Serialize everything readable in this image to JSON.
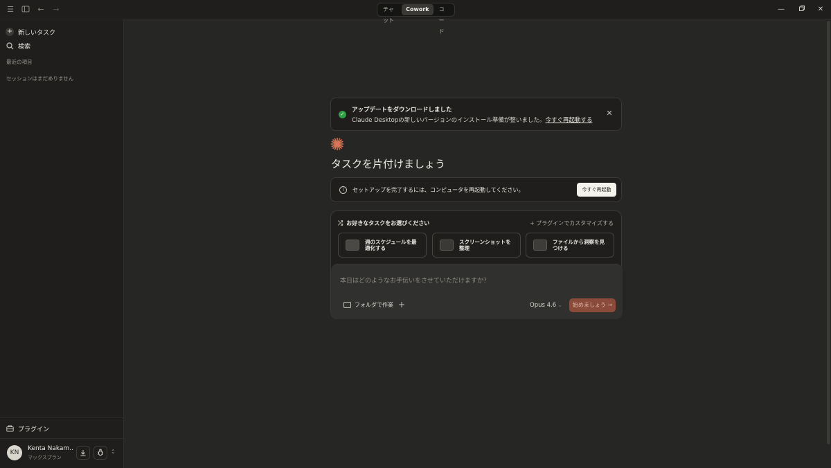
{
  "titlebar": {
    "modes": [
      "チャット",
      "Cowork",
      "コード"
    ],
    "active_mode": "Cowork"
  },
  "sidebar": {
    "new_task": "新しいタスク",
    "search": "検索",
    "recent_section": "最近の項目",
    "empty_sessions": "セッションはまだありません",
    "plugins": "プラグイン",
    "user": {
      "initials": "KN",
      "name": "Kenta Nakam…",
      "plan": "マックスプラン"
    }
  },
  "update_banner": {
    "title": "アップデートをダウンロードしました",
    "text": "Claude Desktopの新しいバージョンのインストール準備が整いました。",
    "link": "今すぐ再起動する"
  },
  "main": {
    "title": "タスクを片付けましょう"
  },
  "restart_notice": {
    "text": "セットアップを完了するには、コンピュータを再起動してください。",
    "button": "今すぐ再起動"
  },
  "task_picker": {
    "heading": "お好きなタスクをお選びください",
    "customize": "+ プラグインでカスタマイズする",
    "options": [
      "週のスケジュールを最適化する",
      "スクリーンショットを整理",
      "ファイルから洞察を見つける"
    ]
  },
  "composer": {
    "placeholder": "本日はどのようなお手伝いをさせていただけますか？",
    "folder": "フォルダで作業",
    "model": "Opus 4.6",
    "start": "始めましょう →"
  },
  "colors": {
    "accent": "#d97757",
    "start_button": "#8a4b3a",
    "success": "#2ea043"
  }
}
